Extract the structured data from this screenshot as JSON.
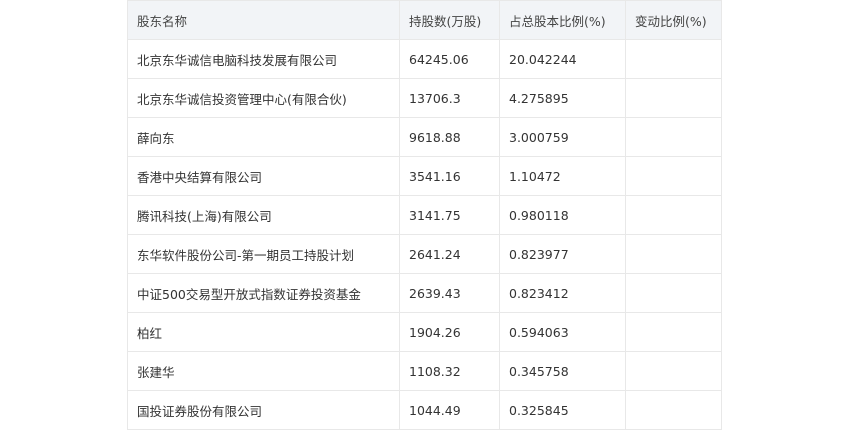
{
  "table": {
    "headers": [
      "股东名称",
      "持股数(万股)",
      "占总股本比例(%)",
      "变动比例(%)"
    ],
    "rows": [
      [
        "北京东华诚信电脑科技发展有限公司",
        "64245.06",
        "20.042244",
        ""
      ],
      [
        "北京东华诚信投资管理中心(有限合伙)",
        "13706.3",
        "4.275895",
        ""
      ],
      [
        "薛向东",
        "9618.88",
        "3.000759",
        ""
      ],
      [
        "香港中央结算有限公司",
        "3541.16",
        "1.10472",
        ""
      ],
      [
        "腾讯科技(上海)有限公司",
        "3141.75",
        "0.980118",
        ""
      ],
      [
        "东华软件股份公司-第一期员工持股计划",
        "2641.24",
        "0.823977",
        ""
      ],
      [
        "中证500交易型开放式指数证券投资基金",
        "2639.43",
        "0.823412",
        ""
      ],
      [
        "柏红",
        "1904.26",
        "0.594063",
        ""
      ],
      [
        "张建华",
        "1108.32",
        "0.345758",
        ""
      ],
      [
        "国投证券股份有限公司",
        "1044.49",
        "0.325845",
        ""
      ]
    ]
  }
}
